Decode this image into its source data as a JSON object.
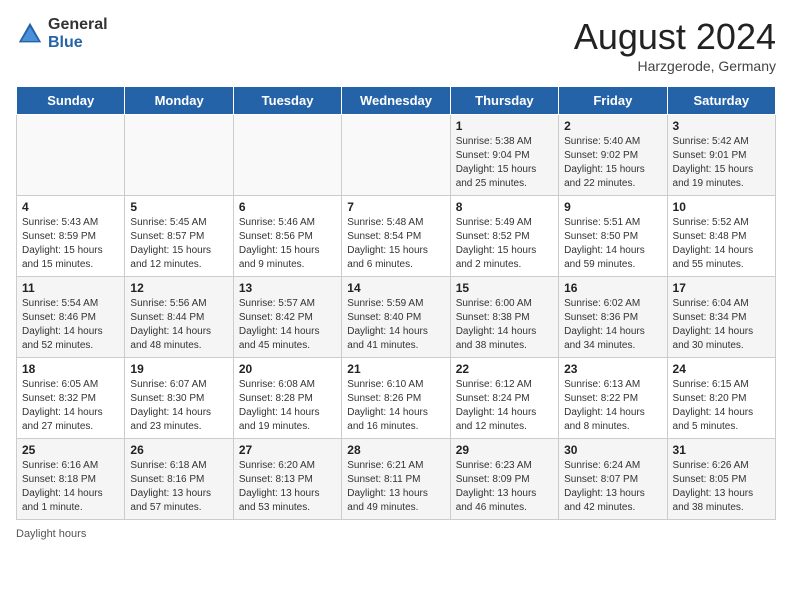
{
  "header": {
    "logo_general": "General",
    "logo_blue": "Blue",
    "month_year": "August 2024",
    "location": "Harzgerode, Germany"
  },
  "days_of_week": [
    "Sunday",
    "Monday",
    "Tuesday",
    "Wednesday",
    "Thursday",
    "Friday",
    "Saturday"
  ],
  "weeks": [
    [
      {
        "day": "",
        "sunrise": "",
        "sunset": "",
        "daylight": ""
      },
      {
        "day": "",
        "sunrise": "",
        "sunset": "",
        "daylight": ""
      },
      {
        "day": "",
        "sunrise": "",
        "sunset": "",
        "daylight": ""
      },
      {
        "day": "",
        "sunrise": "",
        "sunset": "",
        "daylight": ""
      },
      {
        "day": "1",
        "sunrise": "5:38 AM",
        "sunset": "9:04 PM",
        "daylight": "15 hours and 25 minutes."
      },
      {
        "day": "2",
        "sunrise": "5:40 AM",
        "sunset": "9:02 PM",
        "daylight": "15 hours and 22 minutes."
      },
      {
        "day": "3",
        "sunrise": "5:42 AM",
        "sunset": "9:01 PM",
        "daylight": "15 hours and 19 minutes."
      }
    ],
    [
      {
        "day": "4",
        "sunrise": "5:43 AM",
        "sunset": "8:59 PM",
        "daylight": "15 hours and 15 minutes."
      },
      {
        "day": "5",
        "sunrise": "5:45 AM",
        "sunset": "8:57 PM",
        "daylight": "15 hours and 12 minutes."
      },
      {
        "day": "6",
        "sunrise": "5:46 AM",
        "sunset": "8:56 PM",
        "daylight": "15 hours and 9 minutes."
      },
      {
        "day": "7",
        "sunrise": "5:48 AM",
        "sunset": "8:54 PM",
        "daylight": "15 hours and 6 minutes."
      },
      {
        "day": "8",
        "sunrise": "5:49 AM",
        "sunset": "8:52 PM",
        "daylight": "15 hours and 2 minutes."
      },
      {
        "day": "9",
        "sunrise": "5:51 AM",
        "sunset": "8:50 PM",
        "daylight": "14 hours and 59 minutes."
      },
      {
        "day": "10",
        "sunrise": "5:52 AM",
        "sunset": "8:48 PM",
        "daylight": "14 hours and 55 minutes."
      }
    ],
    [
      {
        "day": "11",
        "sunrise": "5:54 AM",
        "sunset": "8:46 PM",
        "daylight": "14 hours and 52 minutes."
      },
      {
        "day": "12",
        "sunrise": "5:56 AM",
        "sunset": "8:44 PM",
        "daylight": "14 hours and 48 minutes."
      },
      {
        "day": "13",
        "sunrise": "5:57 AM",
        "sunset": "8:42 PM",
        "daylight": "14 hours and 45 minutes."
      },
      {
        "day": "14",
        "sunrise": "5:59 AM",
        "sunset": "8:40 PM",
        "daylight": "14 hours and 41 minutes."
      },
      {
        "day": "15",
        "sunrise": "6:00 AM",
        "sunset": "8:38 PM",
        "daylight": "14 hours and 38 minutes."
      },
      {
        "day": "16",
        "sunrise": "6:02 AM",
        "sunset": "8:36 PM",
        "daylight": "14 hours and 34 minutes."
      },
      {
        "day": "17",
        "sunrise": "6:04 AM",
        "sunset": "8:34 PM",
        "daylight": "14 hours and 30 minutes."
      }
    ],
    [
      {
        "day": "18",
        "sunrise": "6:05 AM",
        "sunset": "8:32 PM",
        "daylight": "14 hours and 27 minutes."
      },
      {
        "day": "19",
        "sunrise": "6:07 AM",
        "sunset": "8:30 PM",
        "daylight": "14 hours and 23 minutes."
      },
      {
        "day": "20",
        "sunrise": "6:08 AM",
        "sunset": "8:28 PM",
        "daylight": "14 hours and 19 minutes."
      },
      {
        "day": "21",
        "sunrise": "6:10 AM",
        "sunset": "8:26 PM",
        "daylight": "14 hours and 16 minutes."
      },
      {
        "day": "22",
        "sunrise": "6:12 AM",
        "sunset": "8:24 PM",
        "daylight": "14 hours and 12 minutes."
      },
      {
        "day": "23",
        "sunrise": "6:13 AM",
        "sunset": "8:22 PM",
        "daylight": "14 hours and 8 minutes."
      },
      {
        "day": "24",
        "sunrise": "6:15 AM",
        "sunset": "8:20 PM",
        "daylight": "14 hours and 5 minutes."
      }
    ],
    [
      {
        "day": "25",
        "sunrise": "6:16 AM",
        "sunset": "8:18 PM",
        "daylight": "14 hours and 1 minute."
      },
      {
        "day": "26",
        "sunrise": "6:18 AM",
        "sunset": "8:16 PM",
        "daylight": "13 hours and 57 minutes."
      },
      {
        "day": "27",
        "sunrise": "6:20 AM",
        "sunset": "8:13 PM",
        "daylight": "13 hours and 53 minutes."
      },
      {
        "day": "28",
        "sunrise": "6:21 AM",
        "sunset": "8:11 PM",
        "daylight": "13 hours and 49 minutes."
      },
      {
        "day": "29",
        "sunrise": "6:23 AM",
        "sunset": "8:09 PM",
        "daylight": "13 hours and 46 minutes."
      },
      {
        "day": "30",
        "sunrise": "6:24 AM",
        "sunset": "8:07 PM",
        "daylight": "13 hours and 42 minutes."
      },
      {
        "day": "31",
        "sunrise": "6:26 AM",
        "sunset": "8:05 PM",
        "daylight": "13 hours and 38 minutes."
      }
    ]
  ],
  "footer": {
    "daylight_label": "Daylight hours"
  }
}
